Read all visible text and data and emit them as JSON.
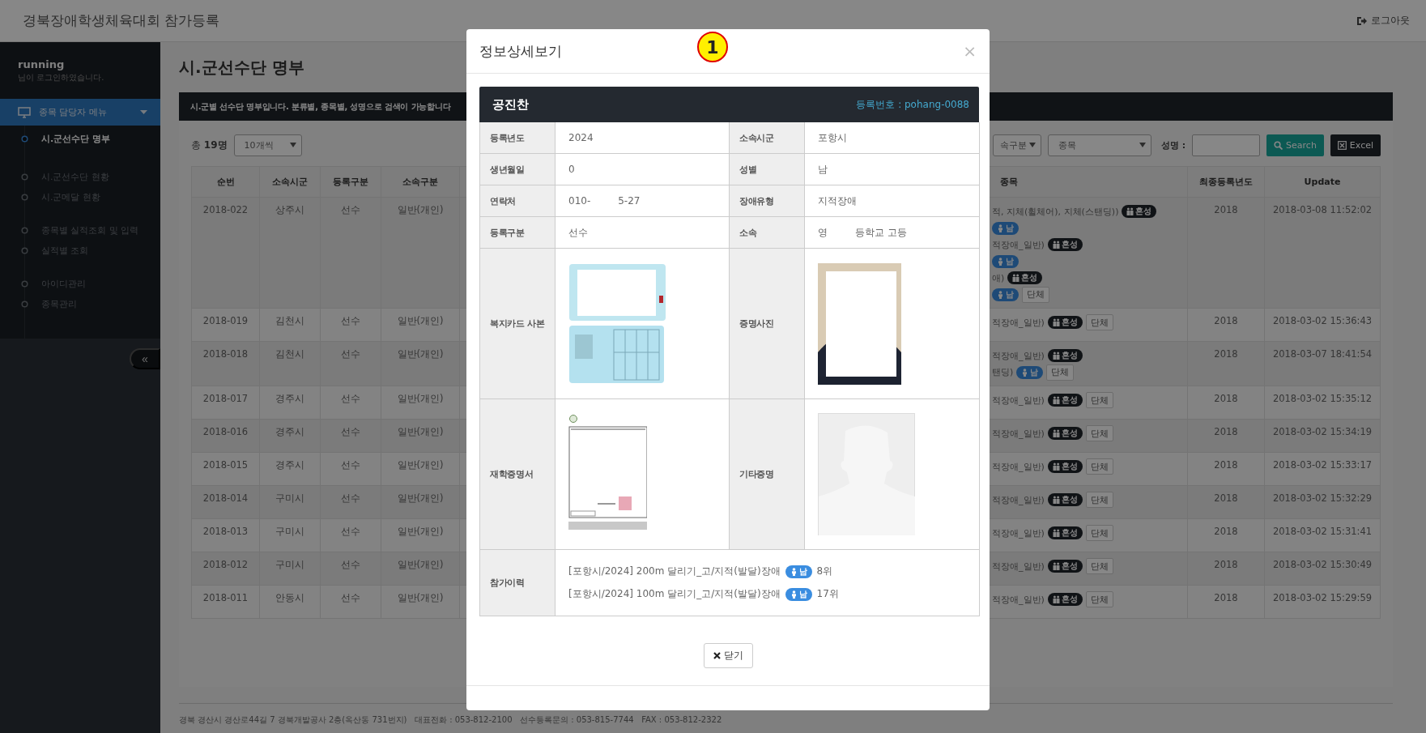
{
  "header": {
    "title": "경북장애학생체육대회 참가등록",
    "logout": "로그아웃"
  },
  "sidebar": {
    "user": "running",
    "greeting": "님이 로그인하였습니다.",
    "menu": {
      "label": "종목 담당자 메뉴",
      "expanded": true,
      "groups": [
        [
          {
            "label": "시.군선수단 명부",
            "selected": true
          }
        ],
        [
          {
            "label": "시.군선수단 현황",
            "selected": false
          },
          {
            "label": "시.군메달 현황",
            "selected": false
          }
        ],
        [
          {
            "label": "종목별 실적조회 및 입력",
            "selected": false
          },
          {
            "label": "실적별 조회",
            "selected": false
          }
        ],
        [
          {
            "label": "아이디관리",
            "selected": false
          },
          {
            "label": "종목관리",
            "selected": false
          }
        ]
      ]
    },
    "collapse": "«"
  },
  "page": {
    "title": "시.군선수단 명부",
    "notice": "시.군별 선수단 명부입니다. 분류별, 종목별, 성명으로 검색이 가능합니다",
    "total": "총 **19명**",
    "per_page": "10개씩",
    "filters": [
      "속구분",
      "종목"
    ],
    "name_label": "성명 :",
    "search_button": "Search",
    "excel_button": "Excel"
  },
  "table": {
    "columns": [
      "순번",
      "소속시군",
      "등록구분",
      "소속구분",
      "종목",
      "최종등록년도",
      "Update"
    ],
    "rows": [
      {
        "no": "2018-022",
        "city": "상주시",
        "type": "선수",
        "group": "일반(개인)",
        "events": [
          {
            "text": "적, 지체(휠체어), 지체(스탠딩))",
            "badges": [
              {
                "kind": "mixed",
                "label": "혼성"
              }
            ]
          },
          {
            "badges": [
              {
                "kind": "male",
                "label": "남"
              }
            ]
          },
          {
            "text": "적장애_일반)",
            "badges": [
              {
                "kind": "mixed",
                "label": "혼성"
              }
            ]
          },
          {
            "badges": [
              {
                "kind": "male",
                "label": "남"
              }
            ]
          },
          {
            "text": "애)",
            "badges": [
              {
                "kind": "mixed",
                "label": "혼성"
              }
            ]
          },
          {
            "badges": [
              {
                "kind": "male",
                "label": "남"
              },
              {
                "kind": "team",
                "label": "단체"
              }
            ]
          }
        ],
        "year": "2018",
        "updated": "2018-03-08 11:52:02"
      },
      {
        "no": "2018-019",
        "city": "김천시",
        "type": "선수",
        "group": "일반(개인)",
        "events": [
          {
            "text": "적장애_일반)",
            "badges": [
              {
                "kind": "mixed",
                "label": "혼성"
              },
              {
                "kind": "team",
                "label": "단체"
              }
            ]
          }
        ],
        "year": "2018",
        "updated": "2018-03-02 15:36:43"
      },
      {
        "no": "2018-018",
        "city": "김천시",
        "type": "선수",
        "group": "일반(개인)",
        "events": [
          {
            "text": "적장애_일반)",
            "badges": [
              {
                "kind": "mixed",
                "label": "혼성"
              }
            ]
          },
          {
            "text": "탠딩)",
            "badges": [
              {
                "kind": "male",
                "label": "남"
              },
              {
                "kind": "team",
                "label": "단체"
              }
            ]
          }
        ],
        "year": "2018",
        "updated": "2018-03-07 18:41:54"
      },
      {
        "no": "2018-017",
        "city": "경주시",
        "type": "선수",
        "group": "일반(개인)",
        "events": [
          {
            "text": "적장애_일반)",
            "badges": [
              {
                "kind": "mixed",
                "label": "혼성"
              },
              {
                "kind": "team",
                "label": "단체"
              }
            ]
          }
        ],
        "year": "2018",
        "updated": "2018-03-02 15:35:12"
      },
      {
        "no": "2018-016",
        "city": "경주시",
        "type": "선수",
        "group": "일반(개인)",
        "events": [
          {
            "text": "적장애_일반)",
            "badges": [
              {
                "kind": "mixed",
                "label": "혼성"
              },
              {
                "kind": "team",
                "label": "단체"
              }
            ]
          }
        ],
        "year": "2018",
        "updated": "2018-03-02 15:34:19"
      },
      {
        "no": "2018-015",
        "city": "경주시",
        "type": "선수",
        "group": "일반(개인)",
        "events": [
          {
            "text": "적장애_일반)",
            "badges": [
              {
                "kind": "mixed",
                "label": "혼성"
              },
              {
                "kind": "team",
                "label": "단체"
              }
            ]
          }
        ],
        "year": "2018",
        "updated": "2018-03-02 15:33:17"
      },
      {
        "no": "2018-014",
        "city": "구미시",
        "type": "선수",
        "group": "일반(개인)",
        "events": [
          {
            "text": "적장애_일반)",
            "badges": [
              {
                "kind": "mixed",
                "label": "혼성"
              },
              {
                "kind": "team",
                "label": "단체"
              }
            ]
          }
        ],
        "year": "2018",
        "updated": "2018-03-02 15:32:29"
      },
      {
        "no": "2018-013",
        "city": "구미시",
        "type": "선수",
        "group": "일반(개인)",
        "events": [
          {
            "text": "적장애_일반)",
            "badges": [
              {
                "kind": "mixed",
                "label": "혼성"
              },
              {
                "kind": "team",
                "label": "단체"
              }
            ]
          }
        ],
        "year": "2018",
        "updated": "2018-03-02 15:31:41"
      },
      {
        "no": "2018-012",
        "city": "구미시",
        "type": "선수",
        "group": "일반(개인)",
        "events": [
          {
            "text": "적장애_일반)",
            "badges": [
              {
                "kind": "mixed",
                "label": "혼성"
              },
              {
                "kind": "team",
                "label": "단체"
              }
            ]
          }
        ],
        "year": "2018",
        "updated": "2018-03-02 15:30:49"
      },
      {
        "no": "2018-011",
        "city": "안동시",
        "type": "선수",
        "group": "일반(개인)",
        "events": [
          {
            "text": "적장애_일반)",
            "badges": [
              {
                "kind": "mixed",
                "label": "혼성"
              },
              {
                "kind": "team",
                "label": "단체"
              }
            ]
          }
        ],
        "year": "2018",
        "updated": "2018-03-02 15:29:59"
      }
    ]
  },
  "footer": "경북 경산시 경산로44길 7 경북개발공사 2층(옥산동 731번지)   대표전화 : 053-812-2100   선수등록문의 : 053-815-7744   FAX : 053-812-2322",
  "modal": {
    "title": "정보상세보기",
    "marker": "1",
    "close": "×",
    "name": "공진찬",
    "registration": "등록번호 : pohang-0088",
    "fields": [
      [
        {
          "label": "등록년도",
          "parts": [
            "2024"
          ]
        },
        {
          "label": "소속시군",
          "parts": [
            "포항시"
          ]
        }
      ],
      [
        {
          "label": "생년월일",
          "parts": [
            "0"
          ]
        },
        {
          "label": "성별",
          "parts": [
            "남"
          ]
        }
      ],
      [
        {
          "label": "연락처",
          "parts": [
            "010-",
            "5-27"
          ]
        },
        {
          "label": "장애유형",
          "parts": [
            "지적장애"
          ]
        }
      ],
      [
        {
          "label": "등록구분",
          "parts": [
            "선수"
          ]
        },
        {
          "label": "소속",
          "parts": [
            "영",
            "등학교 고등"
          ]
        }
      ]
    ],
    "images": [
      [
        {
          "label": "복지카드 사본",
          "kind": "picture"
        },
        {
          "label": "증명사진",
          "kind": "picture"
        }
      ],
      [
        {
          "label": "재학증명서",
          "kind": "picture"
        },
        {
          "label": "기타증명",
          "kind": "picture"
        }
      ]
    ],
    "history_label": "참가이력",
    "history": [
      {
        "text": "[포항시/2024] 200m 달리기_고/지적(발달)장애",
        "badge": {
          "kind": "male",
          "label": "남"
        },
        "rank": "8위"
      },
      {
        "text": "[포항시/2024] 100m 달리기_고/지적(발달)장애",
        "badge": {
          "kind": "male",
          "label": "남"
        },
        "rank": "17위"
      }
    ],
    "close_button": "닫기"
  }
}
